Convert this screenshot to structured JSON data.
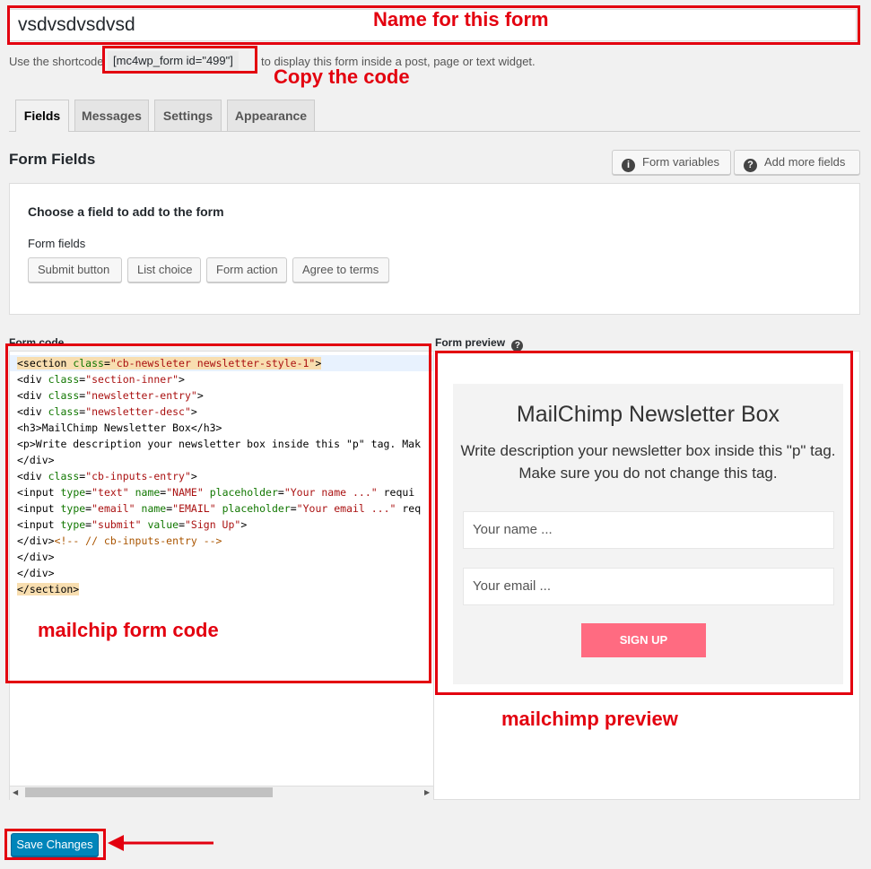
{
  "form_title": "vsdvsdvsdvsd",
  "shortcode": {
    "before": "Use the shortcode",
    "code": "[mc4wp_form id=\"499\"]",
    "after": "to display this form inside a post, page or text widget."
  },
  "tabs": [
    {
      "label": "Fields",
      "active": true
    },
    {
      "label": "Messages",
      "active": false
    },
    {
      "label": "Settings",
      "active": false
    },
    {
      "label": "Appearance",
      "active": false
    }
  ],
  "section_title": "Form Fields",
  "header_buttons": {
    "form_variables": "Form variables",
    "add_more_fields": "Add more fields"
  },
  "field_panel": {
    "heading": "Choose a field to add to the form",
    "subheading": "Form fields",
    "buttons": [
      "Submit button",
      "List choice",
      "Form action",
      "Agree to terms"
    ]
  },
  "form_code_label": "Form code",
  "form_preview_label": "Form preview",
  "code_lines": [
    "<section class=\"cb-newsleter newsletter-style-1\">",
    "<div class=\"section-inner\">",
    "<div class=\"newsletter-entry\">",
    "<div class=\"newsletter-desc\">",
    "<h3>MailChimp Newsletter Box</h3>",
    "<p>Write description your newsletter box inside this \"p\" tag. Mak",
    "</div>",
    "<div class=\"cb-inputs-entry\">",
    "<input type=\"text\" name=\"NAME\" placeholder=\"Your name ...\" requi",
    "<input type=\"email\" name=\"EMAIL\" placeholder=\"Your email ...\" req",
    "<input type=\"submit\" value=\"Sign Up\">",
    "</div><!-- // cb-inputs-entry -->",
    "</div>",
    "</div>",
    "</section>"
  ],
  "preview": {
    "title": "MailChimp Newsletter Box",
    "description": "Write description your newsletter box inside this \"p\" tag. Make sure you do not change this tag.",
    "name_placeholder": "Your name ...",
    "email_placeholder": "Your email ...",
    "submit_label": "SIGN UP"
  },
  "save_button": "Save Changes",
  "annotations": {
    "name": "Name for this form",
    "copy": "Copy the code",
    "code": "mailchip form code",
    "preview": "mailchimp preview"
  },
  "colors": {
    "annotation_red": "#e3000f",
    "primary_button": "#0085ba",
    "signup_button": "#ff6b81"
  },
  "icons": {
    "info": "info-circle-icon",
    "help": "question-circle-icon",
    "arrow": "left-arrow-icon"
  }
}
